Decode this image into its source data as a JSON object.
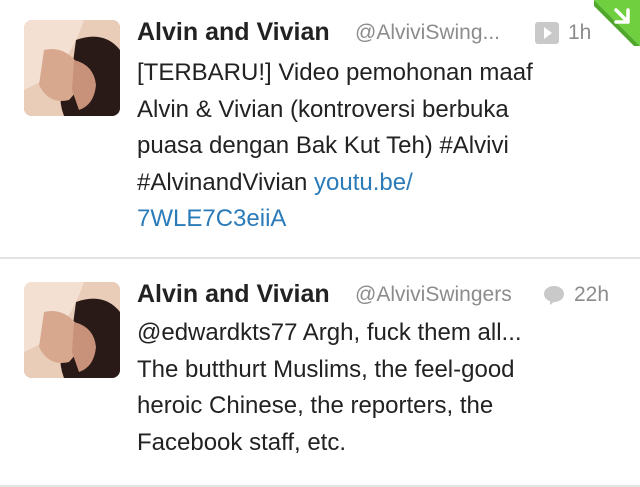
{
  "tweets": [
    {
      "name": "Alvin and Vivian",
      "handle": "@AlviviSwing...",
      "time": "1h",
      "media_icon": "play-icon",
      "text_lines": [
        "[TERBARU!] Video pemohonan maaf",
        "Alvin & Vivian (kontroversi berbuka",
        "puasa dengan Bak Kut Teh) #Alvivi"
      ],
      "line4_text": "#AlvinandVivian ",
      "link_part1": "youtu.be/",
      "link_part2": "7WLE7C3eiiA"
    },
    {
      "name": "Alvin and Vivian",
      "handle": "@AlviviSwingers",
      "time": "22h",
      "media_icon": "reply-bubble-icon",
      "text_lines": [
        "@edwardkts77 Argh, fuck them all...",
        "The butthurt Muslims, the feel-good",
        "heroic Chinese, the reporters, the",
        "Facebook staff, etc."
      ]
    }
  ],
  "colors": {
    "link": "#2b7bb9",
    "meta": "#8c8c8c",
    "text": "#222222",
    "corner": "#6fcf3f"
  },
  "icons": {
    "corner": "green-corner-arrow-icon"
  }
}
